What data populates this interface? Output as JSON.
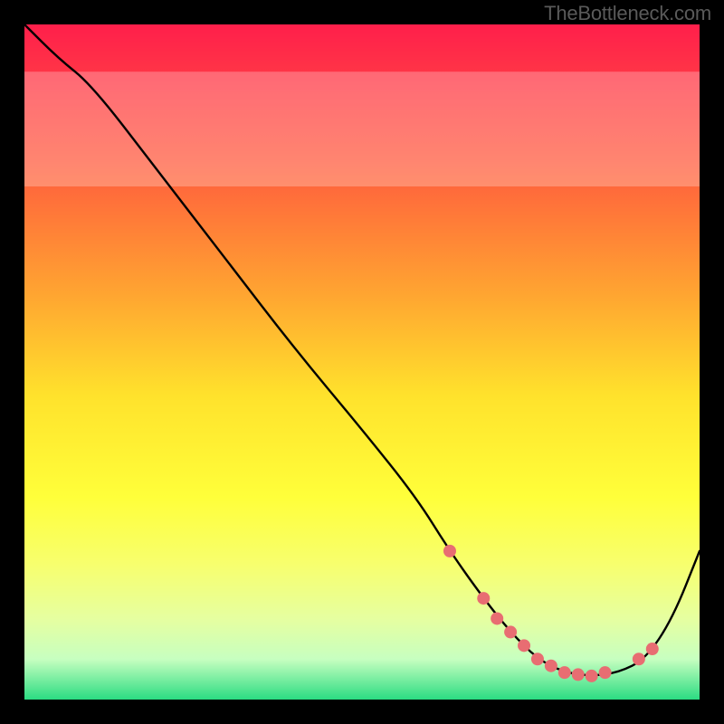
{
  "watermark": "TheBottleneck.com",
  "chart_data": {
    "type": "line",
    "title": "",
    "xlabel": "",
    "ylabel": "",
    "xlim": [
      0,
      100
    ],
    "ylim": [
      0,
      100
    ],
    "background_gradient": {
      "stops": [
        {
          "offset": 0,
          "color": "#ff1f4b"
        },
        {
          "offset": 20,
          "color": "#ff5a3e"
        },
        {
          "offset": 40,
          "color": "#ffa531"
        },
        {
          "offset": 55,
          "color": "#ffe22c"
        },
        {
          "offset": 70,
          "color": "#ffff3a"
        },
        {
          "offset": 80,
          "color": "#f7ff6e"
        },
        {
          "offset": 88,
          "color": "#e6ffa0"
        },
        {
          "offset": 94,
          "color": "#c7ffc0"
        },
        {
          "offset": 100,
          "color": "#2bdc82"
        }
      ]
    },
    "pale_band": {
      "y0": 76,
      "y1": 93
    },
    "curve": {
      "name": "bottleneck-curve",
      "x": [
        0,
        5,
        10,
        20,
        30,
        40,
        50,
        58,
        63,
        68,
        72,
        76,
        80,
        84,
        88,
        92,
        96,
        100
      ],
      "y": [
        100,
        95,
        91,
        78,
        65,
        52,
        40,
        30,
        22,
        15,
        10,
        6,
        4,
        3.5,
        4,
        6,
        12,
        22
      ]
    },
    "points": {
      "name": "highlighted-points",
      "color": "#e86d72",
      "radius": 7,
      "x": [
        63,
        68,
        70,
        72,
        74,
        76,
        78,
        80,
        82,
        84,
        86,
        91,
        93
      ],
      "y": [
        22,
        15,
        12,
        10,
        8,
        6,
        5,
        4,
        3.7,
        3.5,
        4,
        6,
        7.5
      ]
    }
  }
}
